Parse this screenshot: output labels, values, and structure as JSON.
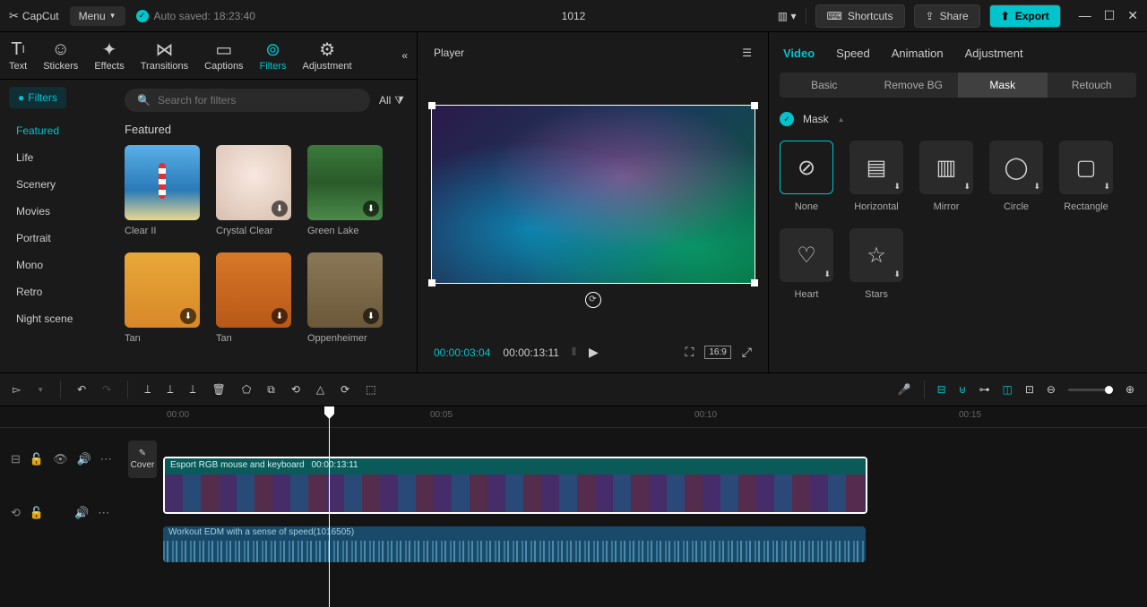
{
  "app": {
    "name": "CapCut",
    "menu": "Menu",
    "autosave": "Auto saved: 18:23:40",
    "project": "1012"
  },
  "titlebar": {
    "shortcuts": "Shortcuts",
    "share": "Share",
    "export": "Export"
  },
  "topTabs": [
    "Text",
    "Stickers",
    "Effects",
    "Transitions",
    "Captions",
    "Filters",
    "Adjustment"
  ],
  "sidebar": {
    "badge": "Filters",
    "items": [
      "Featured",
      "Life",
      "Scenery",
      "Movies",
      "Portrait",
      "Mono",
      "Retro",
      "Night scene"
    ]
  },
  "search": {
    "placeholder": "Search for filters",
    "all": "All"
  },
  "section": "Featured",
  "thumbs": [
    {
      "label": "Clear II"
    },
    {
      "label": "Crystal Clear"
    },
    {
      "label": "Green Lake"
    },
    {
      "label": "Tan"
    },
    {
      "label": "Tan"
    },
    {
      "label": "Oppenheimer"
    }
  ],
  "player": {
    "title": "Player",
    "current": "00:00:03:04",
    "total": "00:00:13:11",
    "ratio": "16:9"
  },
  "right": {
    "tabs": [
      "Video",
      "Speed",
      "Animation",
      "Adjustment"
    ],
    "subtabs": [
      "Basic",
      "Remove BG",
      "Mask",
      "Retouch"
    ],
    "maskTitle": "Mask",
    "masks": [
      "None",
      "Horizontal",
      "Mirror",
      "Circle",
      "Rectangle",
      "Heart",
      "Stars"
    ]
  },
  "ruler": [
    "00:00",
    "00:05",
    "00:10",
    "00:15"
  ],
  "cover": "Cover",
  "clip": {
    "name": "Esport RGB mouse and keyboard",
    "dur": "00:00:13:11"
  },
  "audio": {
    "name": "Workout EDM with a sense of speed(1016505)"
  }
}
